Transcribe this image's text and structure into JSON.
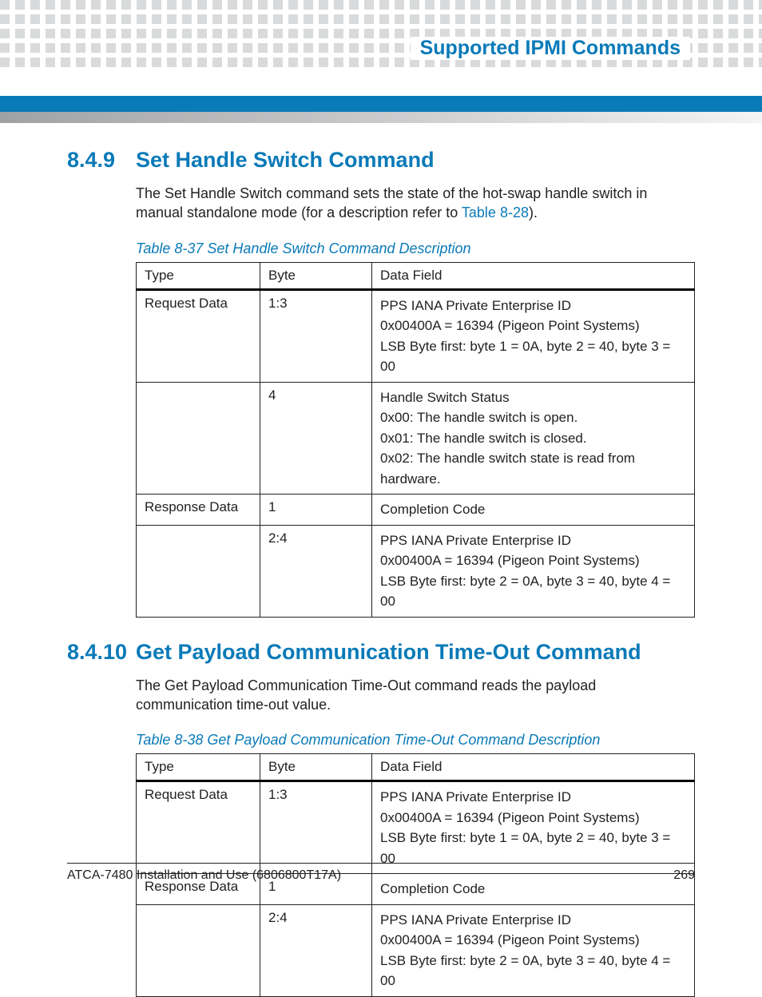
{
  "header": {
    "running_title": "Supported IPMI Commands"
  },
  "section1": {
    "number": "8.4.9",
    "title": "Set Handle Switch Command",
    "para_pre": "The Set Handle Switch command sets the state of the hot-swap handle switch in manual standalone mode (for a description refer to ",
    "xref": "Table 8-28",
    "para_post": ").",
    "table_caption": "Table 8-37 Set Handle Switch Command Description",
    "columns": [
      "Type",
      "Byte",
      "Data Field"
    ],
    "rows": [
      {
        "type": "Request Data",
        "byte": "1:3",
        "data": [
          "PPS IANA Private Enterprise ID",
          "0x00400A = 16394 (Pigeon Point Systems)",
          "LSB Byte first: byte 1 = 0A, byte 2 = 40, byte 3 = 00"
        ]
      },
      {
        "type": "",
        "byte": "4",
        "data": [
          "Handle Switch Status",
          "0x00: The handle switch is open.",
          "0x01: The handle switch is closed.",
          "0x02: The handle switch state is read from hardware."
        ]
      },
      {
        "type": "Response Data",
        "byte": "1",
        "data": [
          "Completion Code"
        ]
      },
      {
        "type": "",
        "byte": "2:4",
        "data": [
          "PPS IANA Private Enterprise ID",
          "0x00400A = 16394 (Pigeon Point Systems)",
          "LSB Byte first: byte 2 = 0A, byte 3 = 40, byte 4 = 00"
        ]
      }
    ]
  },
  "section2": {
    "number": "8.4.10",
    "title": "Get Payload Communication Time-Out Command",
    "para": "The Get Payload Communication Time-Out command reads the payload communication time-out value.",
    "table_caption": "Table 8-38 Get Payload Communication Time-Out Command Description",
    "columns": [
      "Type",
      "Byte",
      "Data Field"
    ],
    "rows": [
      {
        "type": "Request Data",
        "byte": "1:3",
        "data": [
          "PPS IANA Private Enterprise ID",
          "0x00400A = 16394 (Pigeon Point Systems)",
          "LSB Byte first: byte 1 = 0A, byte 2 = 40, byte 3 = 00"
        ]
      },
      {
        "type": "Response Data",
        "byte": "1",
        "data": [
          "Completion Code"
        ]
      },
      {
        "type": "",
        "byte": "2:4",
        "data": [
          "PPS IANA Private Enterprise ID",
          "0x00400A = 16394 (Pigeon Point Systems)",
          "LSB Byte first: byte 2 = 0A, byte 3 = 40, byte 4 = 00"
        ]
      }
    ]
  },
  "footer": {
    "doc": "ATCA-7480 Installation and Use (6806800T17A)",
    "page": "269"
  }
}
